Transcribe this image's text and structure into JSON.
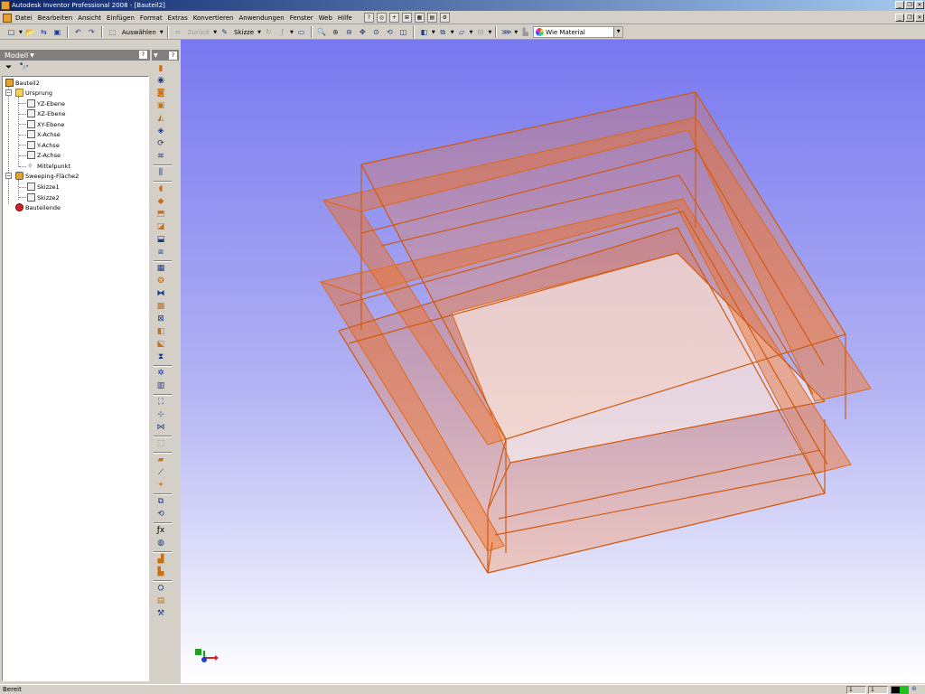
{
  "window": {
    "title": "Autodesk Inventor Professional 2008 - [Bauteil2]",
    "buttons": [
      "_",
      "❐",
      "✕"
    ],
    "mdi_buttons": [
      "_",
      "❐",
      "✕"
    ]
  },
  "menu": {
    "items": [
      "Datei",
      "Bearbeiten",
      "Ansicht",
      "Einfügen",
      "Format",
      "Extras",
      "Konvertieren",
      "Anwendungen",
      "Fenster",
      "Web",
      "Hilfe"
    ]
  },
  "toolbar": {
    "select_label": "Auswählen",
    "back_label": "Zurück",
    "sketch_label": "Skizze",
    "material": "Wie Material"
  },
  "browser": {
    "header": "Modell",
    "help": "?",
    "tree": [
      {
        "label": "Bauteil2"
      },
      {
        "label": "Ursprung"
      },
      {
        "label": "YZ-Ebene"
      },
      {
        "label": "XZ-Ebene"
      },
      {
        "label": "XY-Ebene"
      },
      {
        "label": "X-Achse"
      },
      {
        "label": "Y-Achse"
      },
      {
        "label": "Z-Achse"
      },
      {
        "label": "Mittelpunkt"
      },
      {
        "label": "Sweeping-Fläche2"
      },
      {
        "label": "Skizze1"
      },
      {
        "label": "Skizze2"
      },
      {
        "label": "Bauteilende"
      }
    ]
  },
  "status": {
    "text": "Bereit",
    "cell1": "1",
    "cell2": "1"
  },
  "colors": {
    "model_edge": "#e06818",
    "model_face": "#f08a3c",
    "viewport_top": "#7878f0"
  }
}
